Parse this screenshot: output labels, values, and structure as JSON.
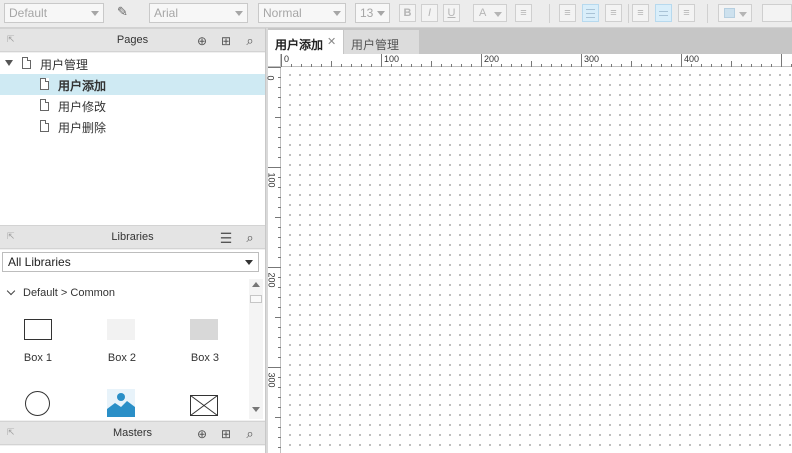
{
  "toolbar": {
    "style_value": "Default",
    "font_value": "Arial",
    "weight_value": "Normal",
    "size_value": "13",
    "bold_label": "B",
    "italic_label": "I",
    "underline_label": "U",
    "font_color_label": "A"
  },
  "pages_panel": {
    "title": "Pages",
    "items": [
      {
        "label": "用户管理",
        "level": 0
      },
      {
        "label": "用户添加",
        "level": 1,
        "selected": true
      },
      {
        "label": "用户修改",
        "level": 1
      },
      {
        "label": "用户删除",
        "level": 1
      }
    ]
  },
  "libraries_panel": {
    "title": "Libraries",
    "selected_library": "All Libraries",
    "path": "Default > Common",
    "widgets": [
      {
        "label": "Box 1"
      },
      {
        "label": "Box 2"
      },
      {
        "label": "Box 3"
      }
    ]
  },
  "masters_panel": {
    "title": "Masters"
  },
  "tabs": [
    {
      "label": "用户添加",
      "active": true
    },
    {
      "label": "用户管理",
      "active": false
    }
  ],
  "ruler": {
    "h_ticks": [
      "0",
      "100",
      "200",
      "300",
      "400"
    ],
    "v_ticks": [
      "0",
      "100",
      "200",
      "300"
    ]
  },
  "colors": {
    "selection": "#cfeaf3",
    "accent": "#2a8fc7"
  }
}
